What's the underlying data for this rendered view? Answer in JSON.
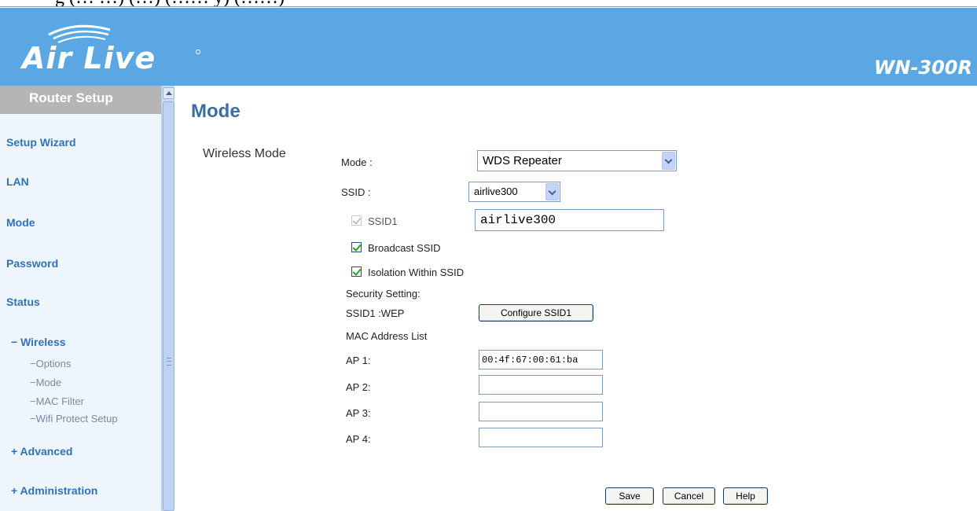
{
  "top_strip": {
    "text": "g (… …) (…) (…… y) (……)"
  },
  "header": {
    "logo_text": "Air Live",
    "model": "WN-300R",
    "colors": {
      "header_bg": "#5ba7e3",
      "sidebar_title_bg": "#b5b5b5",
      "accent_text": "#3a6e9f"
    }
  },
  "sidebar": {
    "title": "Router Setup",
    "items": [
      {
        "label": "Setup Wizard"
      },
      {
        "label": "LAN"
      },
      {
        "label": "Mode"
      },
      {
        "label": "Password"
      },
      {
        "label": "Status"
      }
    ],
    "wireless": {
      "label": "− Wireless",
      "subitems": [
        {
          "label": "−Options"
        },
        {
          "label": "−Mode"
        },
        {
          "label": "−MAC Filter"
        },
        {
          "label": "−Wifi Protect Setup"
        }
      ]
    },
    "advanced": {
      "label": "+ Advanced"
    },
    "administration": {
      "label": "+ Administration"
    }
  },
  "main": {
    "title": "Mode",
    "section": "Wireless Mode",
    "mode": {
      "label": "Mode :",
      "value": "WDS Repeater"
    },
    "ssid": {
      "label": "SSID :",
      "value": "airlive300"
    },
    "ssid1": {
      "label": "SSID1",
      "value": "airlive300",
      "checked": true,
      "disabled": true
    },
    "broadcast": {
      "label": "Broadcast SSID",
      "checked": true
    },
    "isolation": {
      "label": "Isolation Within SSID",
      "checked": true
    },
    "security_heading": "Security Setting:",
    "security": {
      "label": "SSID1 :WEP",
      "button": "Configure SSID1"
    },
    "mac_heading": "MAC Address List",
    "aps": [
      {
        "label": "AP 1:",
        "value": "00:4f:67:00:61:ba"
      },
      {
        "label": "AP 2:",
        "value": ""
      },
      {
        "label": "AP 3:",
        "value": ""
      },
      {
        "label": "AP 4:",
        "value": ""
      }
    ],
    "buttons": {
      "save": "Save",
      "cancel": "Cancel",
      "help": "Help"
    }
  }
}
